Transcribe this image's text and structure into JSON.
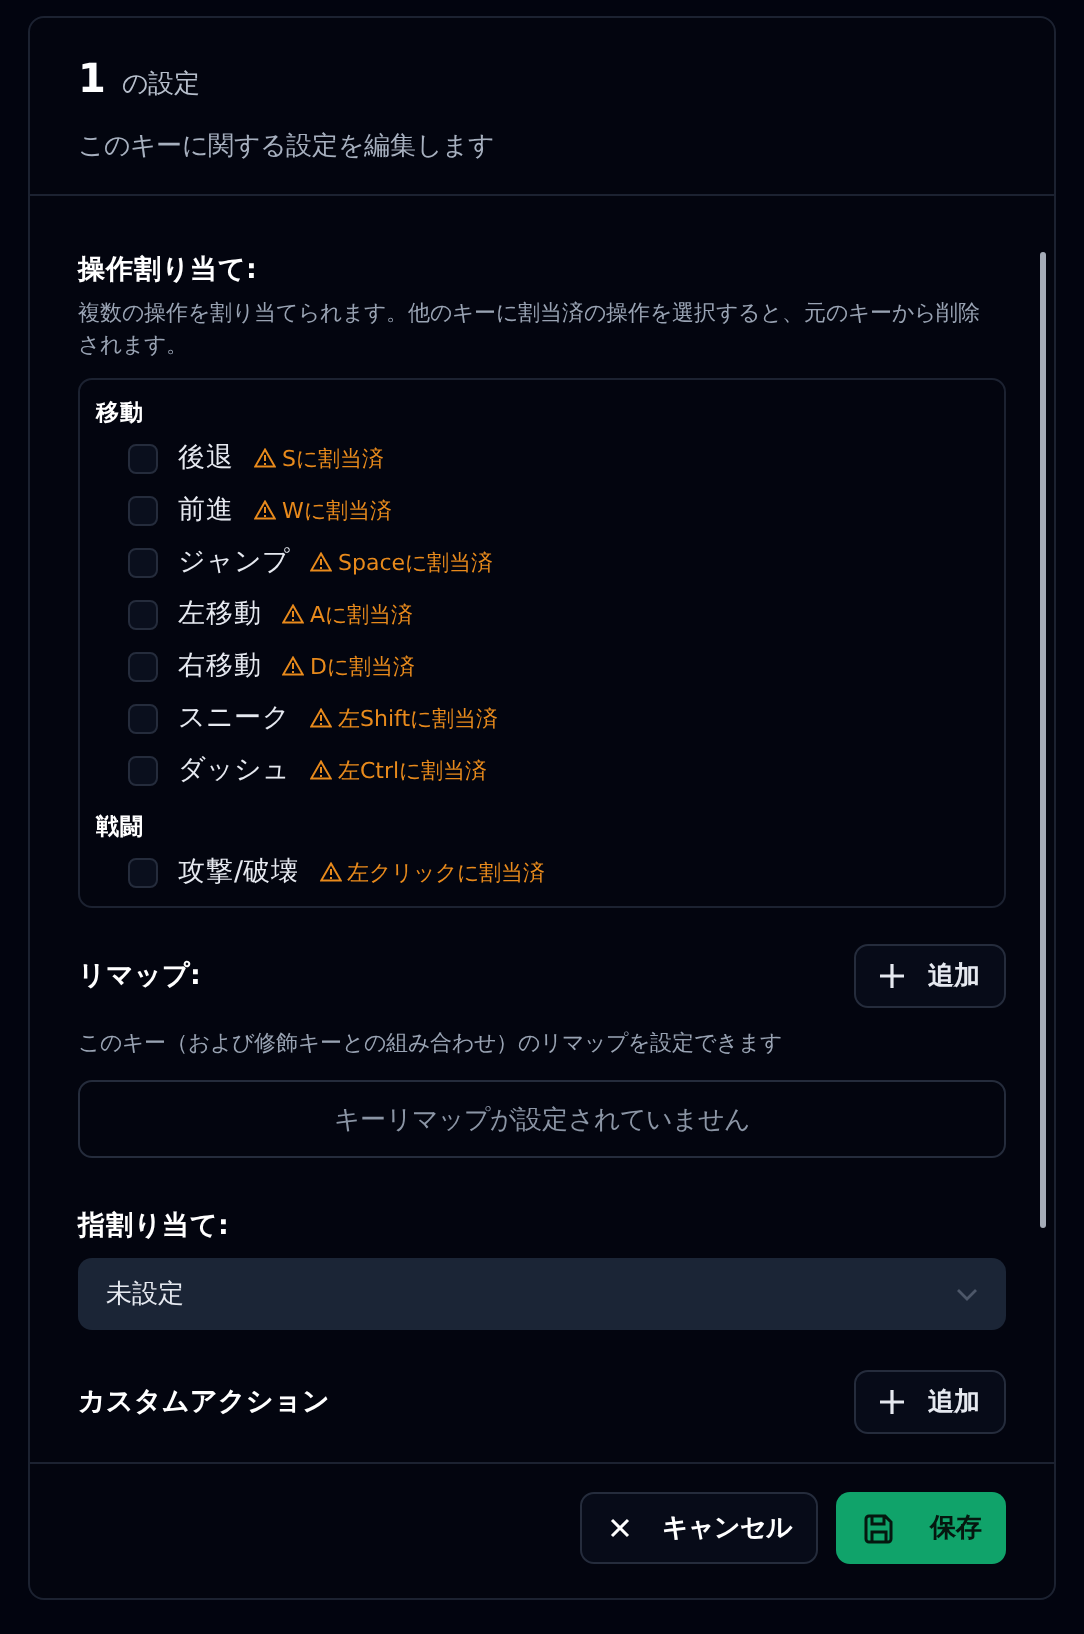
{
  "dialog": {
    "key": "1",
    "title": "の設定",
    "subtitle": "このキーに関する設定を編集します"
  },
  "actions_section": {
    "title": "操作割り当て:",
    "description": "複数の操作を割り当てられます。他のキーに割当済の操作を選択すると、元のキーから削除されます。",
    "groups": [
      {
        "name": "移動",
        "items": [
          {
            "label": "後退",
            "checked": false,
            "assigned": "Sに割当済"
          },
          {
            "label": "前進",
            "checked": false,
            "assigned": "Wに割当済"
          },
          {
            "label": "ジャンプ",
            "checked": false,
            "assigned": "Spaceに割当済"
          },
          {
            "label": "左移動",
            "checked": false,
            "assigned": "Aに割当済"
          },
          {
            "label": "右移動",
            "checked": false,
            "assigned": "Dに割当済"
          },
          {
            "label": "スニーク",
            "checked": false,
            "assigned": "左Shiftに割当済"
          },
          {
            "label": "ダッシュ",
            "checked": false,
            "assigned": "左Ctrlに割当済"
          }
        ]
      },
      {
        "name": "戦闘",
        "items": [
          {
            "label": "攻撃/破壊",
            "checked": false,
            "assigned": "左クリックに割当済"
          }
        ]
      }
    ]
  },
  "remap_section": {
    "title": "リマップ:",
    "add_button": "追加",
    "description": "このキー（および修飾キーとの組み合わせ）のリマップを設定できます",
    "empty_message": "キーリマップが設定されていません"
  },
  "finger_section": {
    "title": "指割り当て:",
    "value": "未設定"
  },
  "custom_action_section": {
    "title": "カスタムアクション",
    "add_button": "追加"
  },
  "footer": {
    "cancel_button": "キャンセル",
    "save_button": "保存"
  }
}
